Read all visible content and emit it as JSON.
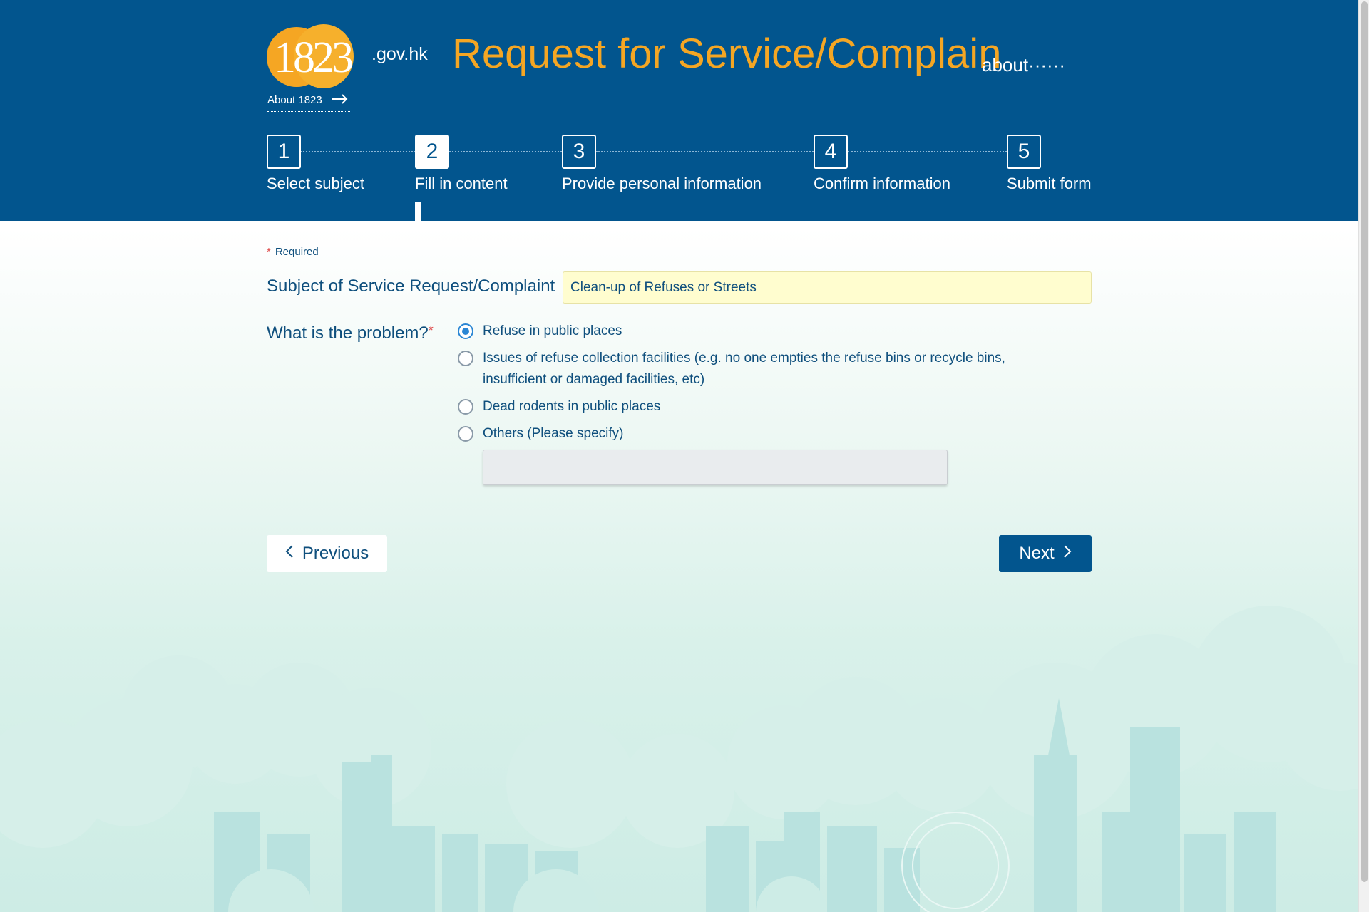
{
  "header": {
    "logo_text": "1823",
    "logo_domain": ".gov.hk",
    "about_link": "About 1823",
    "title": "Request for Service/Complain",
    "subtitle": "about······"
  },
  "steps": [
    {
      "number": "1",
      "label": "Select subject",
      "active": false
    },
    {
      "number": "2",
      "label": "Fill in content",
      "active": true
    },
    {
      "number": "3",
      "label": "Provide personal information",
      "active": false
    },
    {
      "number": "4",
      "label": "Confirm information",
      "active": false
    },
    {
      "number": "5",
      "label": "Submit form",
      "active": false
    }
  ],
  "form": {
    "required_note": "Required",
    "required_mark": "*",
    "subject_label": "Subject of Service Request/Complaint",
    "subject_value": "Clean-up of Refuses or Streets",
    "problem_label": "What is the problem?",
    "options": [
      {
        "label": "Refuse in public places",
        "checked": true
      },
      {
        "label": "Issues of refuse collection facilities (e.g. no one empties the refuse bins or recycle bins, insufficient or damaged facilities, etc)",
        "checked": false
      },
      {
        "label": "Dead rodents in public places",
        "checked": false
      },
      {
        "label": "Others (Please specify)",
        "checked": false
      }
    ],
    "others_value": ""
  },
  "nav": {
    "previous_label": "Previous",
    "next_label": "Next"
  },
  "colors": {
    "header_bg": "#02558e",
    "accent_orange": "#f5a623",
    "text_blue": "#0f4f7d",
    "subject_bg": "#fffdcf"
  }
}
